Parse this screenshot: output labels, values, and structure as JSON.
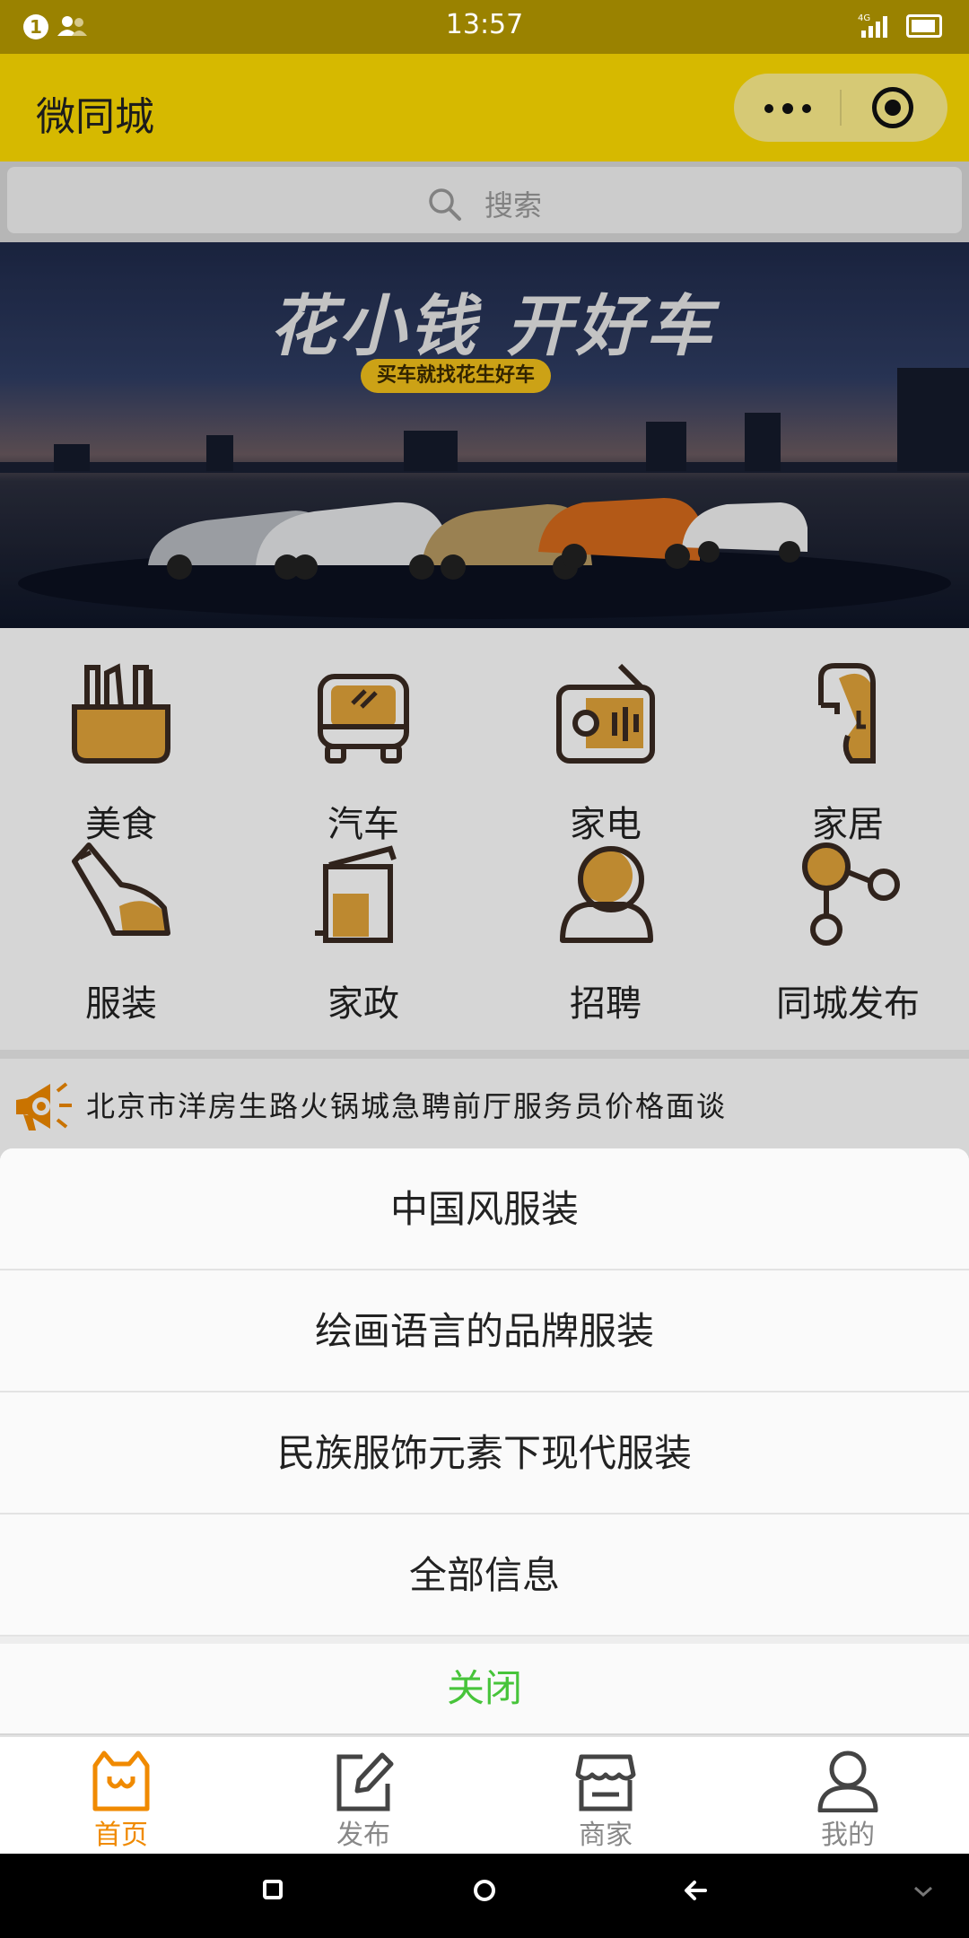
{
  "status_bar": {
    "time": "13:57",
    "notification_count": "1",
    "network": "4G"
  },
  "header": {
    "title": "微同城",
    "more_icon": "more-dots-icon",
    "close_icon": "target-circle-icon"
  },
  "search": {
    "placeholder": "搜索"
  },
  "banner": {
    "headline": "花小钱 开好车",
    "subline": "买车就找花生好车"
  },
  "categories": [
    {
      "label": "美食",
      "icon": "food-basket-icon"
    },
    {
      "label": "汽车",
      "icon": "bus-icon"
    },
    {
      "label": "家电",
      "icon": "radio-icon"
    },
    {
      "label": "家居",
      "icon": "lamp-icon"
    },
    {
      "label": "服装",
      "icon": "shoe-icon"
    },
    {
      "label": "家政",
      "icon": "trash-bin-icon"
    },
    {
      "label": "招聘",
      "icon": "recruit-person-icon"
    },
    {
      "label": "同城发布",
      "icon": "share-nodes-icon"
    }
  ],
  "notice": {
    "text": "北京市洋房生路火锅城急聘前厅服务员价格面谈",
    "icon": "megaphone-icon"
  },
  "action_sheet": {
    "items": [
      "中国风服装",
      "绘画语言的品牌服装",
      "民族服饰元素下现代服装",
      "全部信息"
    ],
    "close_label": "关闭"
  },
  "tabbar": {
    "items": [
      {
        "label": "首页",
        "icon": "home-cat-icon",
        "active": true
      },
      {
        "label": "发布",
        "icon": "edit-icon",
        "active": false
      },
      {
        "label": "商家",
        "icon": "store-icon",
        "active": false
      },
      {
        "label": "我的",
        "icon": "user-icon",
        "active": false
      }
    ]
  },
  "colors": {
    "status_bar": "#9a8200",
    "header": "#ffdd00",
    "icon_fill": "#e2a43a",
    "icon_stroke": "#3a2a22",
    "close_green": "#47c43a",
    "tab_active": "#f08a00"
  }
}
